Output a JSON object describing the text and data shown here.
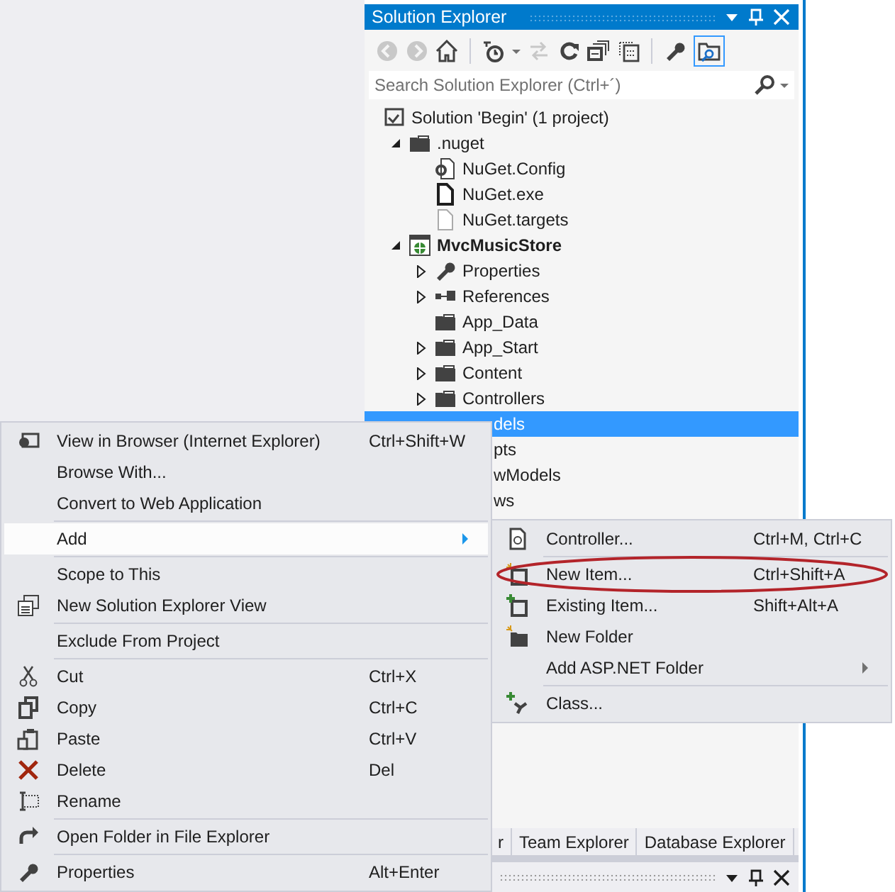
{
  "solution_explorer": {
    "title": "Solution Explorer",
    "search": {
      "placeholder": "Search Solution Explorer (Ctrl+´)"
    },
    "tree": [
      {
        "kind": "solution",
        "label": "Solution 'Begin' (1 project)",
        "selected": false,
        "children": [
          {
            "kind": "folder",
            "label": ".nuget",
            "selected": false,
            "expanded": true,
            "children": [
              {
                "kind": "config-file",
                "label": "NuGet.Config",
                "selected": false
              },
              {
                "kind": "file",
                "label": "NuGet.exe",
                "selected": false
              },
              {
                "kind": "text-file",
                "label": "NuGet.targets",
                "selected": false
              }
            ]
          },
          {
            "kind": "project",
            "label": "MvcMusicStore",
            "bold": true,
            "selected": false,
            "expanded": true,
            "children": [
              {
                "kind": "properties",
                "label": "Properties",
                "selected": false,
                "expanded": false
              },
              {
                "kind": "references",
                "label": "References",
                "selected": false,
                "expanded": false
              },
              {
                "kind": "folder",
                "label": "App_Data",
                "selected": false
              },
              {
                "kind": "folder",
                "label": "App_Start",
                "selected": false,
                "expanded": false
              },
              {
                "kind": "folder",
                "label": "Content",
                "selected": false,
                "expanded": false
              },
              {
                "kind": "folder",
                "label": "Controllers",
                "selected": false,
                "expanded": false
              },
              {
                "kind": "hidden",
                "label": "dels",
                "selected": true
              },
              {
                "kind": "hidden",
                "label": "pts",
                "selected": false
              },
              {
                "kind": "hidden",
                "label": "wModels",
                "selected": false
              },
              {
                "kind": "hidden",
                "label": "ws",
                "selected": false
              }
            ]
          }
        ]
      }
    ],
    "tabs": [
      {
        "label": "r"
      },
      {
        "label": "Team Explorer"
      },
      {
        "label": "Database Explorer"
      }
    ]
  },
  "context_menu": {
    "items": [
      {
        "kind": "item",
        "label": "View in Browser (Internet Explorer)",
        "shortcut": "Ctrl+Shift+W",
        "highlighted": false,
        "submenu": false
      },
      {
        "kind": "item",
        "label": "Browse With...",
        "highlighted": false,
        "submenu": false
      },
      {
        "kind": "item",
        "label": "Convert to Web Application",
        "highlighted": false,
        "submenu": false
      },
      {
        "kind": "separator"
      },
      {
        "kind": "item",
        "label": "Add",
        "highlighted": true,
        "submenu": true
      },
      {
        "kind": "separator"
      },
      {
        "kind": "item",
        "label": "Scope to This",
        "highlighted": false,
        "submenu": false
      },
      {
        "kind": "item",
        "label": "New Solution Explorer View",
        "highlighted": false,
        "submenu": false
      },
      {
        "kind": "separator"
      },
      {
        "kind": "item",
        "label": "Exclude From Project",
        "highlighted": false,
        "submenu": false
      },
      {
        "kind": "separator"
      },
      {
        "kind": "item",
        "label": "Cut",
        "shortcut": "Ctrl+X",
        "highlighted": false,
        "submenu": false
      },
      {
        "kind": "item",
        "label": "Copy",
        "shortcut": "Ctrl+C",
        "highlighted": false,
        "submenu": false
      },
      {
        "kind": "item",
        "label": "Paste",
        "shortcut": "Ctrl+V",
        "highlighted": false,
        "submenu": false
      },
      {
        "kind": "item",
        "label": "Delete",
        "shortcut": "Del",
        "highlighted": false,
        "submenu": false
      },
      {
        "kind": "item",
        "label": "Rename",
        "highlighted": false,
        "submenu": false
      },
      {
        "kind": "separator"
      },
      {
        "kind": "item",
        "label": "Open Folder in File Explorer",
        "highlighted": false,
        "submenu": false
      },
      {
        "kind": "separator"
      },
      {
        "kind": "item",
        "label": "Properties",
        "shortcut": "Alt+Enter",
        "highlighted": false,
        "submenu": false
      }
    ]
  },
  "add_submenu": {
    "items": [
      {
        "kind": "item",
        "label": "Controller...",
        "shortcut": "Ctrl+M, Ctrl+C",
        "highlighted": false,
        "submenu": false,
        "circled": false
      },
      {
        "kind": "separator"
      },
      {
        "kind": "item",
        "label": "New Item...",
        "shortcut": "Ctrl+Shift+A",
        "highlighted": false,
        "submenu": false,
        "circled": true
      },
      {
        "kind": "item",
        "label": "Existing Item...",
        "shortcut": "Shift+Alt+A",
        "highlighted": false,
        "submenu": false,
        "circled": false
      },
      {
        "kind": "item",
        "label": "New Folder",
        "highlighted": false,
        "submenu": false,
        "circled": false
      },
      {
        "kind": "item",
        "label": "Add ASP.NET Folder",
        "highlighted": false,
        "submenu": true,
        "circled": false
      },
      {
        "kind": "separator"
      },
      {
        "kind": "item",
        "label": "Class...",
        "highlighted": false,
        "submenu": false,
        "circled": false
      }
    ]
  }
}
